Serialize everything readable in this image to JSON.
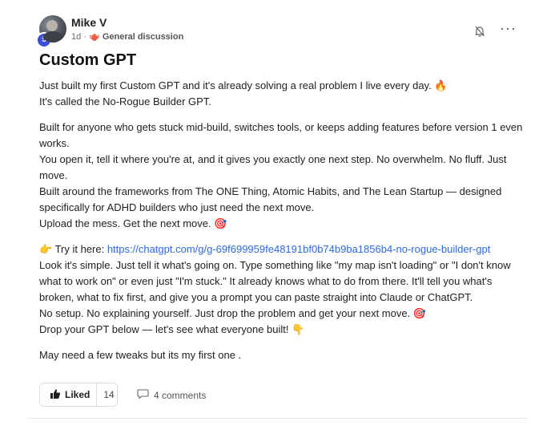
{
  "author": {
    "name": "Mike V",
    "level": "5",
    "time": "1d",
    "separator": "·",
    "category_icon": "🫖",
    "category": "General discussion"
  },
  "post": {
    "title": "Custom GPT",
    "p1": "Just built my first Custom GPT and it's already solving a real problem I live every day. 🔥",
    "p2": "It's called the No-Rogue Builder GPT.",
    "p3": "Built for anyone who gets stuck mid-build, switches tools, or keeps adding features before version 1 even works.",
    "p4": "You open it, tell it where you're at, and it gives you exactly one next step. No overwhelm. No fluff. Just move.",
    "p5": "Built around the frameworks from The ONE Thing, Atomic Habits, and The Lean Startup — designed specifically for ADHD builders who just need the next move.",
    "p6": "Upload the mess. Get the next move. 🎯",
    "try_prefix": "👉 Try it here: ",
    "link": "https://chatgpt.com/g/g-69f699959fe48191bf0b74b9ba1856b4-no-rogue-builder-gpt",
    "p7": "Look it's simple. Just tell it what's going on. Type something like \"my map isn't loading\" or \"I don't know what to work on\" or even just \"I'm stuck.\" It already knows what to do from there. It'll tell you what's broken, what to fix first, and give you a prompt you can paste straight into Claude or ChatGPT.",
    "p8": "No setup. No explaining yourself. Just drop the problem and get your next move. 🎯",
    "p9": "Drop your GPT below — let's see what everyone built! 👇",
    "p10": "May need a few tweaks but its my first one ."
  },
  "actions": {
    "like_label": "Liked",
    "like_count": "14",
    "comments_label": "4 comments"
  },
  "icons": {
    "bell": "bell-off-icon",
    "more": "more-horizontal-icon",
    "like": "thumbs-up-icon",
    "comment": "comment-bubble-icon"
  },
  "colors": {
    "link": "#2d6bd8",
    "level_badge": "#3b4fd8"
  }
}
